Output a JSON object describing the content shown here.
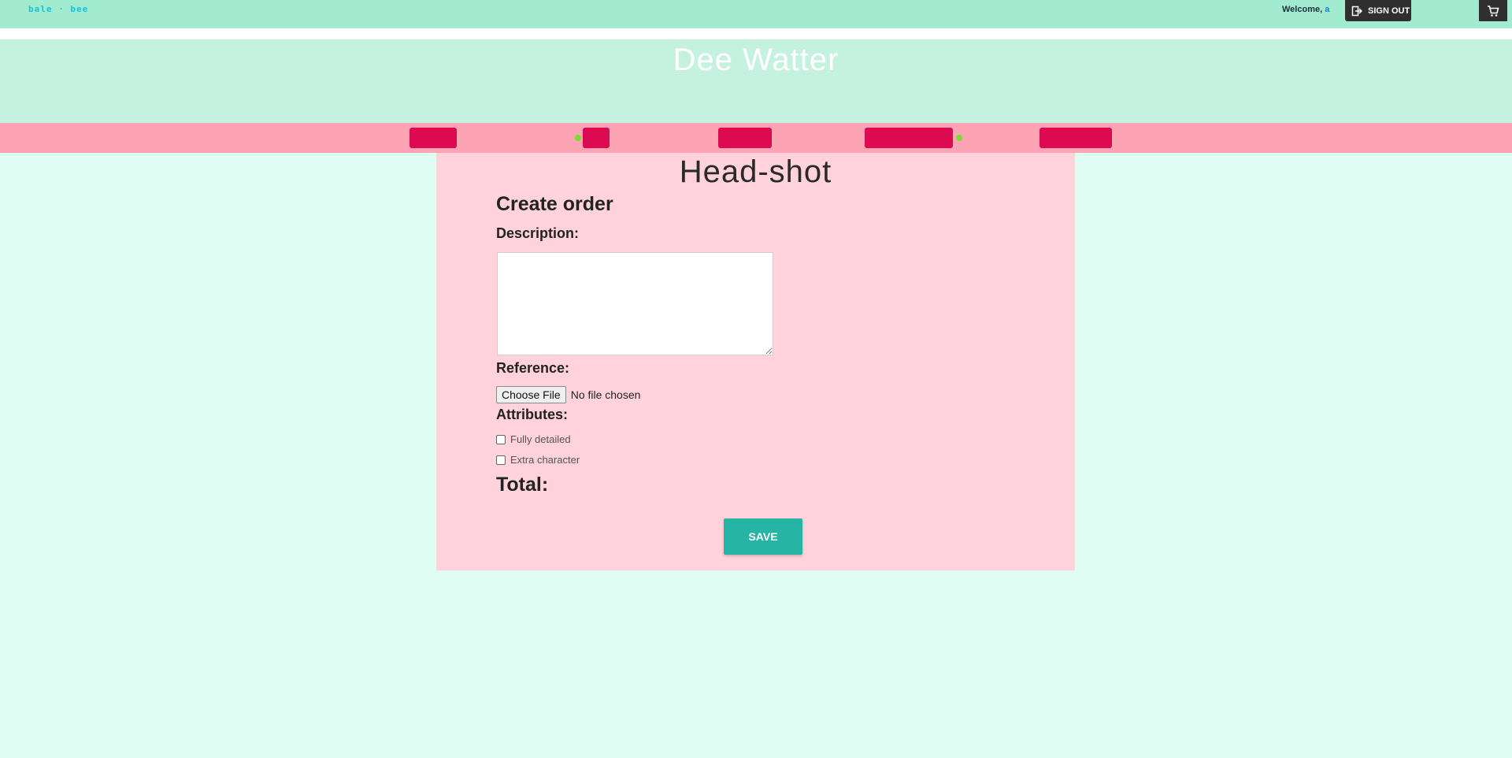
{
  "topbar": {
    "logo_text": "bale · bee",
    "welcome_text": "Welcome, ",
    "username": "a",
    "signout_label": "SIGN OUT"
  },
  "banner": {
    "title": "Dee Watter"
  },
  "nav": {
    "items": [
      {
        "label": ""
      },
      {
        "label": ""
      },
      {
        "label": ""
      },
      {
        "label": ""
      },
      {
        "label": ""
      }
    ]
  },
  "card": {
    "title": "Head-shot",
    "heading": "Create order",
    "description_label": "Description:",
    "description_value": "",
    "reference_label": "Reference:",
    "file_button_label": "Choose File",
    "file_status": "No file chosen",
    "attributes_label": "Attributes:",
    "attributes": [
      {
        "label": "Fully detailed",
        "checked": false
      },
      {
        "label": "Extra character",
        "checked": false
      }
    ],
    "total_label": "Total:",
    "save_label": "SAVE"
  },
  "colors": {
    "topbar": "#a2ebd0",
    "banner": "#c5f1e1",
    "navbar": "#fda4b4",
    "page_bg": "#e0fdf4",
    "card_bg": "#ffd2dc",
    "accent": "#26b5a4",
    "redaction": "#dc0a50"
  }
}
